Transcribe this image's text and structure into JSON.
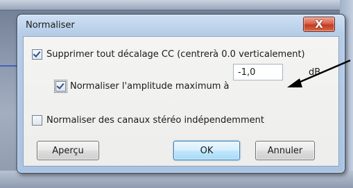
{
  "dialog": {
    "title": "Normaliser",
    "close_label": "X"
  },
  "options": {
    "remove_dc_offset": {
      "label": "Supprimer tout décalage CC (centrerà 0.0 verticalement)",
      "checked": true
    },
    "normalize_peak": {
      "label": "Normaliser l'amplitude maximum à",
      "checked": true,
      "value": "-1,0",
      "unit": "dB"
    },
    "independent_channels": {
      "label": "Normaliser des canaux stéréo indépendemment",
      "checked": false
    }
  },
  "buttons": {
    "preview": "Aperçu",
    "ok": "OK",
    "cancel": "Annuler"
  },
  "colors": {
    "accent": "#2c4d8c",
    "close_red": "#c23b22",
    "dialog_frame": "#b6cde8"
  }
}
